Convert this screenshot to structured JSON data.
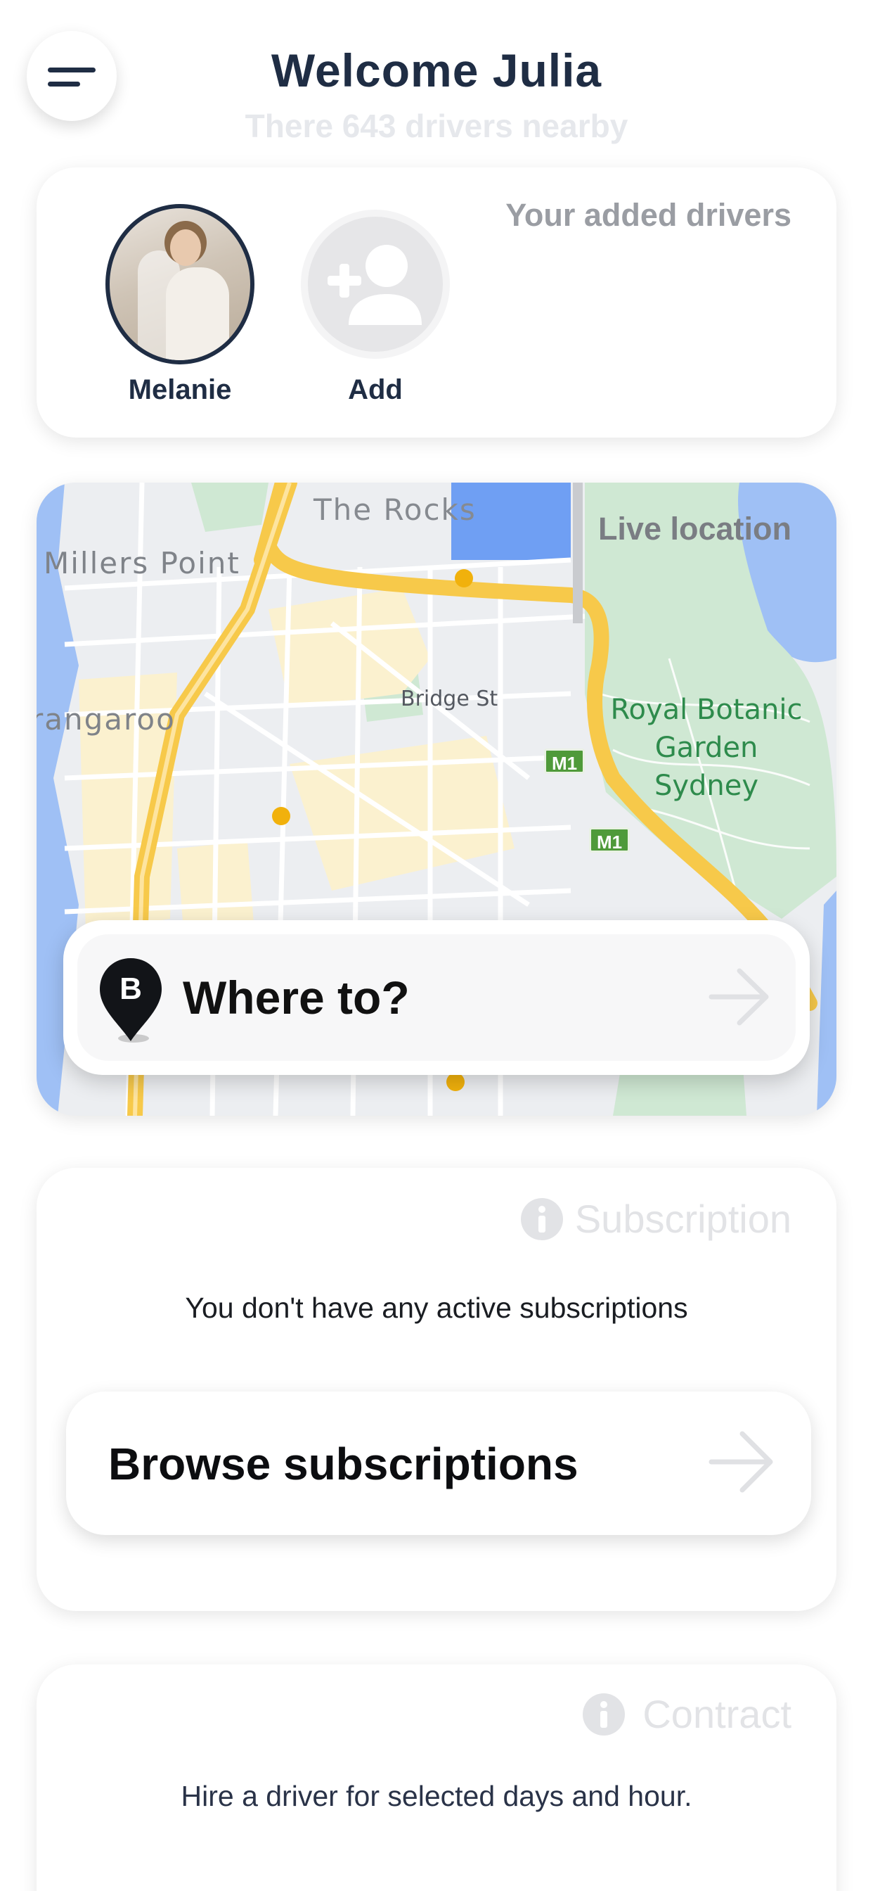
{
  "header": {
    "title": "Welcome Julia",
    "subtitle": "There 643 drivers nearby",
    "menu_icon": "hamburger-menu-icon"
  },
  "drivers": {
    "label": "Your added drivers",
    "items": [
      {
        "name": "Melanie"
      },
      {
        "name": "Add",
        "icon": "add-person-icon"
      }
    ]
  },
  "map": {
    "label": "Live location",
    "places": {
      "the_rocks": "The Rocks",
      "millers_point": "Millers Point",
      "barangaroo": "rangaroo",
      "bridge_st": "Bridge St",
      "royal_botanic": "Royal Botanic Garden Sydney"
    },
    "road_badges": [
      "M1",
      "M1"
    ],
    "search": {
      "placeholder": "Where to?",
      "pin_letter": "B",
      "arrow_icon": "arrow-right-icon"
    }
  },
  "subscription": {
    "label": "Subscription",
    "icon": "info-icon",
    "empty_text": "You don't have any active subscriptions",
    "button_label": "Browse subscriptions"
  },
  "contract": {
    "label": "Contract",
    "icon": "info-icon",
    "text": "Hire a driver for selected days and hour."
  },
  "colors": {
    "primary": "#1f2d44",
    "muted": "#9a9da3",
    "faint": "#e2e3e6",
    "road_major": "#f7c94a",
    "park": "#cfe8d3",
    "water": "#9fc0f5"
  }
}
